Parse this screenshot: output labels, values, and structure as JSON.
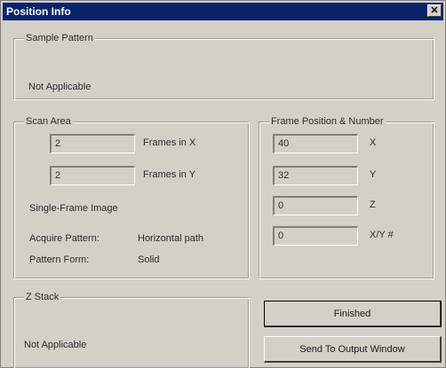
{
  "window": {
    "title": "Position Info",
    "close_glyph": "✕"
  },
  "sample_pattern": {
    "title": "Sample Pattern",
    "value": "Not Applicable"
  },
  "scan_area": {
    "title": "Scan Area",
    "frames_x": {
      "value": "2",
      "label": "Frames in X"
    },
    "frames_y": {
      "value": "2",
      "label": "Frames in Y"
    },
    "single_frame": "Single-Frame Image",
    "acquire_pattern": {
      "label": "Acquire Pattern:",
      "value": "Horizontal path"
    },
    "pattern_form": {
      "label": "Pattern Form:",
      "value": "Solid"
    }
  },
  "frame_position": {
    "title": "Frame Position & Number",
    "x": {
      "value": "40",
      "label": "X"
    },
    "y": {
      "value": "32",
      "label": "Y"
    },
    "z": {
      "value": "0",
      "label": "Z"
    },
    "xy": {
      "value": "0",
      "label": "X/Y #"
    }
  },
  "z_stack": {
    "title": "Z Stack",
    "value": "Not Applicable"
  },
  "buttons": {
    "finished": "Finished",
    "send_to_output": "Send To Output Window"
  }
}
